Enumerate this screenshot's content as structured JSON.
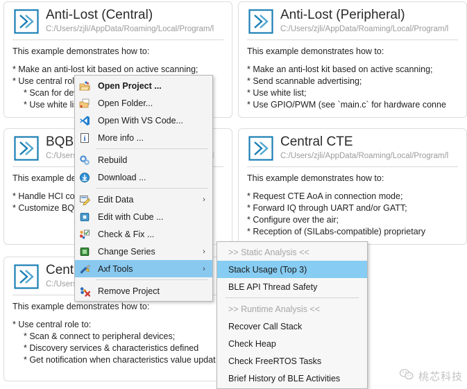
{
  "theme": {
    "accent": "#1a7fb5",
    "menu_bg": "#f4f4f4",
    "submenu_bg": "#f7f7f7",
    "highlight": "#89c9f0",
    "card_border": "#dcdcdc",
    "path_text": "#9b9b9b",
    "disabled_text": "#a6a6a6"
  },
  "cards": [
    {
      "icon": "project-chevron-icon",
      "title": "Anti-Lost (Central)",
      "path": "C:/Users/zjli/AppData/Roaming/Local/Program/l",
      "intro": "This example demonstrates how to:",
      "lines": [
        {
          "text": "* Make an anti-lost kit based on active scanning;",
          "indent": 0
        },
        {
          "text": "* Use central role to:",
          "indent": 0
        },
        {
          "text": "* Scan for devices;",
          "indent": 1
        },
        {
          "text": "* Use white list;",
          "indent": 1
        }
      ]
    },
    {
      "icon": "project-chevron-icon",
      "title": "Anti-Lost (Peripheral)",
      "path": "C:/Users/zjli/AppData/Roaming/Local/Program/l",
      "intro": "This example demonstrates how to:",
      "lines": [
        {
          "text": "* Make an anti-lost kit based on active scanning;",
          "indent": 0
        },
        {
          "text": "* Send scannable advertising;",
          "indent": 0
        },
        {
          "text": "* Use white list;",
          "indent": 0
        },
        {
          "text": "* Use GPIO/PWM (see `main.c` for hardware conne",
          "indent": 0
        }
      ]
    },
    {
      "icon": "project-chevron-icon",
      "title": "BQB",
      "path": "C:/Users/zjli/AppData/Roaming/Local/Program/l",
      "intro": "This example demonstrates how to:",
      "lines": [
        {
          "text": "* Handle HCI commands;",
          "indent": 0
        },
        {
          "text": "* Customize BQB test;",
          "indent": 0
        }
      ]
    },
    {
      "icon": "project-chevron-icon",
      "title": "Central CTE",
      "path": "C:/Users/zjli/AppData/Roaming/Local/Program/l",
      "intro": "This example demonstrates how to:",
      "lines": [
        {
          "text": "* Request CTE AoA in connection mode;",
          "indent": 0
        },
        {
          "text": "* Forward IQ through UART and/or GATT;",
          "indent": 0
        },
        {
          "text": "* Configure over the air;",
          "indent": 0
        },
        {
          "text": "* Reception of (SILabs-compatible) proprietary",
          "indent": 0
        }
      ]
    },
    {
      "icon": "project-chevron-icon",
      "title": "Central",
      "path": "C:/Users/zjli/AppData/Roaming/Local/Progr",
      "intro": "This example demonstrates how to:",
      "lines": [
        {
          "text": "* Use central role to:",
          "indent": 0
        },
        {
          "text": "* Scan & connect to peripheral devices;",
          "indent": 1
        },
        {
          "text": "* Discovery services & characteristics defined",
          "indent": 1
        },
        {
          "text": "* Get notification when characteristics value updat",
          "indent": 1
        }
      ]
    }
  ],
  "context_menu": {
    "items": [
      {
        "kind": "item",
        "icon": "open-project-icon",
        "label": "Open Project ...",
        "bold": true,
        "submenu": false,
        "selected": false,
        "disabled": false
      },
      {
        "kind": "item",
        "icon": "open-folder-icon",
        "label": "Open Folder...",
        "bold": false,
        "submenu": false,
        "selected": false,
        "disabled": false
      },
      {
        "kind": "item",
        "icon": "vscode-icon",
        "label": "Open With VS Code...",
        "bold": false,
        "submenu": false,
        "selected": false,
        "disabled": false
      },
      {
        "kind": "item",
        "icon": "info-icon",
        "label": "More info ...",
        "bold": false,
        "submenu": false,
        "selected": false,
        "disabled": false
      },
      {
        "kind": "sep"
      },
      {
        "kind": "item",
        "icon": "rebuild-gears-icon",
        "label": "Rebuild",
        "bold": false,
        "submenu": false,
        "selected": false,
        "disabled": false
      },
      {
        "kind": "item",
        "icon": "download-icon",
        "label": "Download ...",
        "bold": false,
        "submenu": false,
        "selected": false,
        "disabled": false
      },
      {
        "kind": "sep"
      },
      {
        "kind": "item",
        "icon": "edit-data-icon",
        "label": "Edit Data",
        "bold": false,
        "submenu": true,
        "selected": false,
        "disabled": false
      },
      {
        "kind": "item",
        "icon": "cube-chip-icon",
        "label": "Edit with Cube ...",
        "bold": false,
        "submenu": false,
        "selected": false,
        "disabled": false
      },
      {
        "kind": "item",
        "icon": "check-fix-icon",
        "label": "Check & Fix ...",
        "bold": false,
        "submenu": false,
        "selected": false,
        "disabled": false
      },
      {
        "kind": "item",
        "icon": "chip-icon",
        "label": "Change Series",
        "bold": false,
        "submenu": true,
        "selected": false,
        "disabled": false
      },
      {
        "kind": "item",
        "icon": "tools-icon",
        "label": "Axf Tools",
        "bold": false,
        "submenu": true,
        "selected": true,
        "disabled": false
      },
      {
        "kind": "sep"
      },
      {
        "kind": "item",
        "icon": "remove-project-icon",
        "label": "Remove Project",
        "bold": false,
        "submenu": false,
        "selected": false,
        "disabled": false
      }
    ]
  },
  "submenu": {
    "items": [
      {
        "kind": "item",
        "label": ">> Static Analysis <<",
        "disabled": true,
        "selected": false
      },
      {
        "kind": "item",
        "label": "Stack Usage (Top 3)",
        "disabled": false,
        "selected": true
      },
      {
        "kind": "item",
        "label": "BLE API Thread Safety",
        "disabled": false,
        "selected": false
      },
      {
        "kind": "sep"
      },
      {
        "kind": "item",
        "label": ">> Runtime Analysis <<",
        "disabled": true,
        "selected": false
      },
      {
        "kind": "item",
        "label": "Recover Call Stack",
        "disabled": false,
        "selected": false
      },
      {
        "kind": "item",
        "label": "Check Heap",
        "disabled": false,
        "selected": false
      },
      {
        "kind": "item",
        "label": "Check FreeRTOS Tasks",
        "disabled": false,
        "selected": false
      },
      {
        "kind": "item",
        "label": "Brief History of BLE Activities",
        "disabled": false,
        "selected": false
      }
    ]
  },
  "watermark": {
    "icon": "wechat-logo-icon",
    "text": "桃芯科技"
  }
}
